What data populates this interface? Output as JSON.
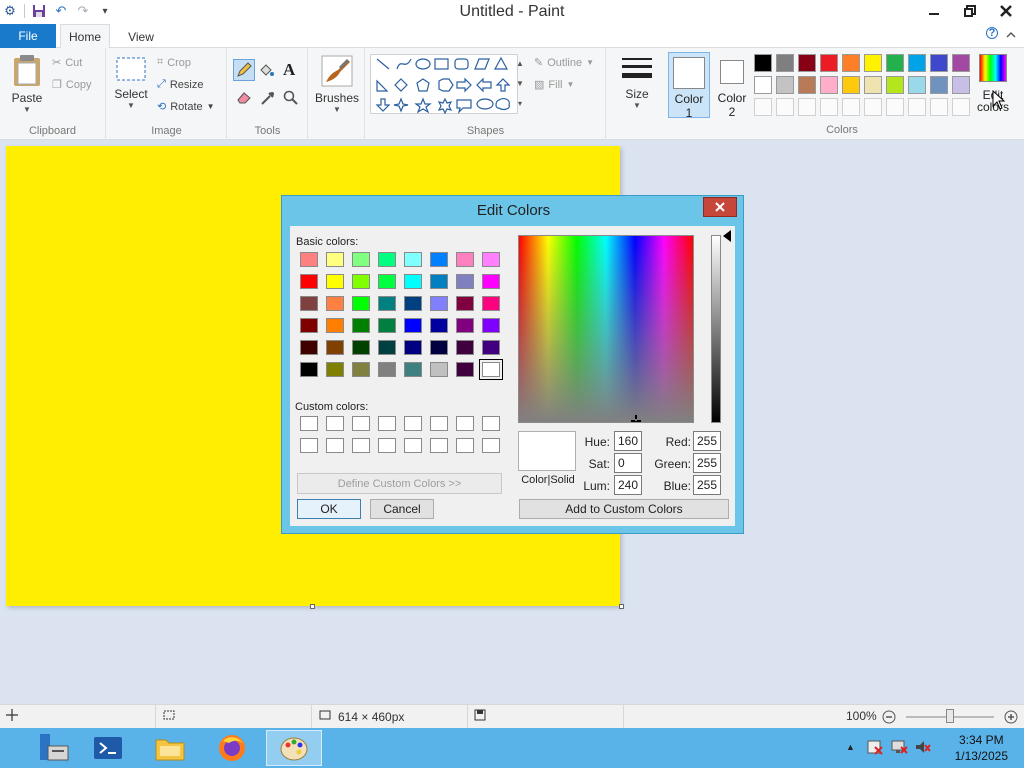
{
  "window": {
    "title": "Untitled - Paint",
    "minimize": "—",
    "restore": "▣",
    "close": "✕"
  },
  "tabs": {
    "file": "File",
    "home": "Home",
    "view": "View"
  },
  "clipboard": {
    "paste": "Paste",
    "cut": "Cut",
    "copy": "Copy",
    "label": "Clipboard"
  },
  "image": {
    "select": "Select",
    "crop": "Crop",
    "resize": "Resize",
    "rotate": "Rotate",
    "label": "Image"
  },
  "tools": {
    "label": "Tools",
    "text_glyph": "A"
  },
  "brushes": {
    "label": "Brushes"
  },
  "shapes": {
    "outline": "Outline",
    "fill": "Fill",
    "label": "Shapes"
  },
  "size": {
    "label": "Size"
  },
  "color1": {
    "label1": "Color",
    "label2": "1",
    "color": "#ffffff"
  },
  "color2": {
    "label1": "Color",
    "label2": "2",
    "color": "#ffffff"
  },
  "colors": {
    "label": "Colors",
    "edit_label1": "Edit",
    "edit_label2": "colors",
    "row1": [
      "#000000",
      "#7f7f7f",
      "#880015",
      "#ed1c24",
      "#ff7f27",
      "#fff200",
      "#22b14c",
      "#00a2e8",
      "#3f48cc",
      "#a349a4"
    ],
    "row2": [
      "#ffffff",
      "#c3c3c3",
      "#b97a57",
      "#ffaec9",
      "#ffc90e",
      "#efe4b0",
      "#b5e61d",
      "#99d9ea",
      "#7092be",
      "#c8bfe7"
    ]
  },
  "canvas": {
    "color": "#ffee00"
  },
  "status": {
    "dimensions": "614 × 460px",
    "zoom": "100%"
  },
  "taskbar": {
    "time": "3:34 PM",
    "date": "1/13/2025"
  },
  "dialog": {
    "title": "Edit Colors",
    "close": "✕",
    "basic_label": "Basic colors:",
    "custom_label": "Custom colors:",
    "basic_colors": [
      [
        "#ff8080",
        "#ffff80",
        "#80ff80",
        "#00ff80",
        "#80ffff",
        "#0080ff",
        "#ff80c0",
        "#ff80ff"
      ],
      [
        "#ff0000",
        "#ffff00",
        "#80ff00",
        "#00ff40",
        "#00ffff",
        "#0080c0",
        "#8080c0",
        "#ff00ff"
      ],
      [
        "#804040",
        "#ff8040",
        "#00ff00",
        "#008080",
        "#004080",
        "#8080ff",
        "#800040",
        "#ff0080"
      ],
      [
        "#800000",
        "#ff8000",
        "#008000",
        "#008040",
        "#0000ff",
        "#0000a0",
        "#800080",
        "#8000ff"
      ],
      [
        "#400000",
        "#804000",
        "#004000",
        "#004040",
        "#000080",
        "#000040",
        "#400040",
        "#400080"
      ],
      [
        "#000000",
        "#808000",
        "#808040",
        "#808080",
        "#408080",
        "#c0c0c0",
        "#400040",
        "#ffffff"
      ]
    ],
    "define_custom": "Define Custom Colors >>",
    "ok": "OK",
    "cancel": "Cancel",
    "color_solid": "Color|Solid",
    "hue_label": "Hue:",
    "hue": "160",
    "sat_label": "Sat:",
    "sat": "0",
    "lum_label": "Lum:",
    "lum": "240",
    "red_label": "Red:",
    "red": "255",
    "green_label": "Green:",
    "green": "255",
    "blue_label": "Blue:",
    "blue": "255",
    "add_custom": "Add to Custom Colors"
  }
}
